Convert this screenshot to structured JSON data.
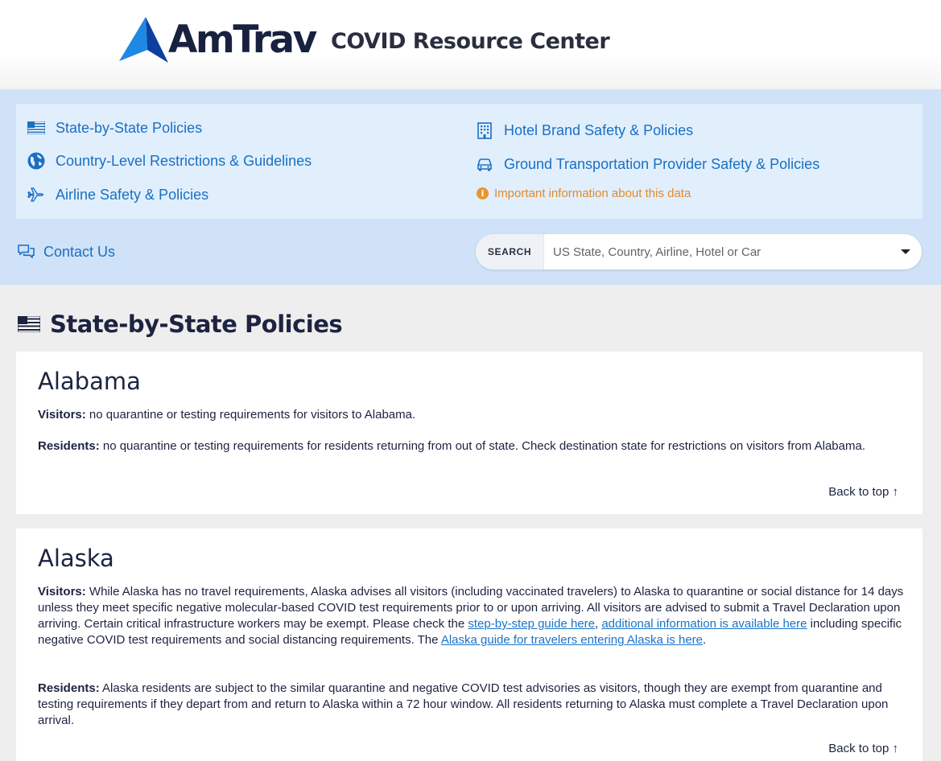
{
  "header": {
    "logo_text": "AmTrav",
    "title": "COVID Resource Center"
  },
  "nav": {
    "items": [
      {
        "label": "State-by-State Policies",
        "icon": "us-flag-icon"
      },
      {
        "label": "Country-Level Restrictions & Guidelines",
        "icon": "globe-icon"
      },
      {
        "label": "Airline Safety & Policies",
        "icon": "airplane-icon"
      },
      {
        "label": "Hotel Brand Safety & Policies",
        "icon": "building-icon"
      },
      {
        "label": "Ground Transportation Provider Safety & Policies",
        "icon": "car-icon"
      }
    ],
    "info_text": "Important information about this data",
    "contact_label": "Contact Us"
  },
  "search": {
    "label": "SEARCH",
    "placeholder": "US State, Country, Airline, Hotel or Car"
  },
  "section": {
    "title": "State-by-State Policies"
  },
  "states": [
    {
      "name": "Alabama",
      "visitors_label": "Visitors:",
      "visitors_text": "no quarantine or testing requirements for visitors to Alabama.",
      "residents_label": "Residents:",
      "residents_text": "no quarantine or testing requirements for residents returning from out of state. Check destination state for restrictions on visitors from Alabama.",
      "back_to_top": "Back to top ↑"
    },
    {
      "name": "Alaska",
      "visitors_label": "Visitors:",
      "visitors_text_1": "While Alaska has no travel requirements, Alaska advises all visitors (including vaccinated travelers) to Alaska to quarantine or social distance for 14 days unless they meet specific negative molecular-based COVID test requirements prior to or upon arriving. All visitors are advised to submit a Travel Declaration upon arriving. Certain critical infrastructure workers may be exempt. Please check the",
      "link_1": "step-by-step guide here",
      "sep_1": ",",
      "link_2": "additional information is available here",
      "visitors_text_2": "including specific negative COVID test requirements and social distancing requirements. The",
      "link_3": "Alaska guide for travelers entering Alaska is here",
      "visitors_text_3": ".",
      "residents_label": "Residents:",
      "residents_text": "Alaska residents are subject to the similar quarantine and negative COVID test advisories as visitors, though they are exempt from quarantine and testing requirements if they depart from and return to Alaska within a 72 hour window. All residents returning to Alaska must complete a Travel Declaration upon arrival.",
      "back_to_top": "Back to top ↑"
    }
  ],
  "colors": {
    "brand_navy": "#18213f",
    "link_blue": "#1b6fc2",
    "nav_band": "#cfe2f7",
    "nav_box": "#e1effd",
    "warning_orange": "#e18a2b"
  }
}
